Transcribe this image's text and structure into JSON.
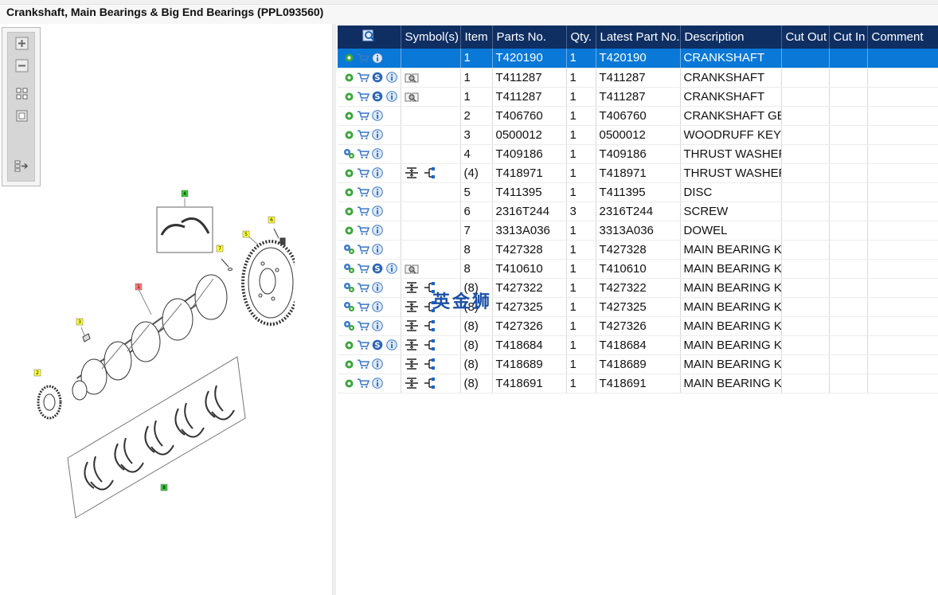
{
  "window": {
    "title": "Crankshaft, Main Bearings & Big End Bearings (PPL093560)"
  },
  "toolbar": {
    "buttons": [
      "zoom-in-icon",
      "zoom-out-icon",
      "fit-page-icon",
      "actual-size-icon",
      "toggle-list-icon"
    ]
  },
  "diagram": {
    "callouts": [
      {
        "id": "c4",
        "label": "4",
        "color": "#33cc33"
      },
      {
        "id": "c6",
        "label": "6",
        "color": "#ffff33"
      },
      {
        "id": "c5",
        "label": "5",
        "color": "#ffff33"
      },
      {
        "id": "c7",
        "label": "7",
        "color": "#ffff33"
      },
      {
        "id": "c1",
        "label": "1",
        "color": "#ff7777"
      },
      {
        "id": "c3",
        "label": "3",
        "color": "#ffff33"
      },
      {
        "id": "c2",
        "label": "2",
        "color": "#ffff33"
      },
      {
        "id": "c8",
        "label": "8",
        "color": "#33cc33"
      }
    ]
  },
  "table": {
    "headers": [
      "",
      "Symbol(s)",
      "Item",
      "Parts No.",
      "Qty.",
      "Latest Part No.",
      "Description",
      "Cut Out",
      "Cut In",
      "Comment"
    ],
    "rows": [
      {
        "icons": [
          "gear",
          "cart",
          "info"
        ],
        "symbols": [],
        "item": "1",
        "part": "T420190",
        "qty": "1",
        "latest": "T420190",
        "desc": "CRANKSHAFT",
        "selected": true
      },
      {
        "icons": [
          "gear",
          "cart",
          "s",
          "info"
        ],
        "symbols": [
          "book"
        ],
        "item": "1",
        "part": "T411287",
        "qty": "1",
        "latest": "T411287",
        "desc": "CRANKSHAFT"
      },
      {
        "icons": [
          "gear",
          "cart",
          "s",
          "info"
        ],
        "symbols": [
          "book"
        ],
        "item": "1",
        "part": "T411287",
        "qty": "1",
        "latest": "T411287",
        "desc": "CRANKSHAFT"
      },
      {
        "icons": [
          "gear",
          "cart",
          "info"
        ],
        "symbols": [],
        "item": "2",
        "part": "T406760",
        "qty": "1",
        "latest": "T406760",
        "desc": "CRANKSHAFT GEAR"
      },
      {
        "icons": [
          "gear",
          "cart",
          "info"
        ],
        "symbols": [],
        "item": "3",
        "part": "0500012",
        "qty": "1",
        "latest": "0500012",
        "desc": "WOODRUFF KEY"
      },
      {
        "icons": [
          "gears",
          "cart",
          "info"
        ],
        "symbols": [],
        "item": "4",
        "part": "T409186",
        "qty": "1",
        "latest": "T409186",
        "desc": "THRUST WASHER"
      },
      {
        "icons": [
          "gear",
          "cart",
          "info"
        ],
        "symbols": [
          "split",
          "tree"
        ],
        "item": "(4)",
        "part": "T418971",
        "qty": "1",
        "latest": "T418971",
        "desc": "THRUST WASHER"
      },
      {
        "icons": [
          "gear",
          "cart",
          "info"
        ],
        "symbols": [],
        "item": "5",
        "part": "T411395",
        "qty": "1",
        "latest": "T411395",
        "desc": "DISC"
      },
      {
        "icons": [
          "gear",
          "cart",
          "info"
        ],
        "symbols": [],
        "item": "6",
        "part": "2316T244",
        "qty": "3",
        "latest": "2316T244",
        "desc": "SCREW"
      },
      {
        "icons": [
          "gear",
          "cart",
          "info"
        ],
        "symbols": [],
        "item": "7",
        "part": "3313A036",
        "qty": "1",
        "latest": "3313A036",
        "desc": "DOWEL"
      },
      {
        "icons": [
          "gears",
          "cart",
          "info"
        ],
        "symbols": [],
        "item": "8",
        "part": "T427328",
        "qty": "1",
        "latest": "T427328",
        "desc": "MAIN BEARING KIT"
      },
      {
        "icons": [
          "gears",
          "cart",
          "s",
          "info"
        ],
        "symbols": [
          "book"
        ],
        "item": "8",
        "part": "T410610",
        "qty": "1",
        "latest": "T410610",
        "desc": "MAIN BEARING KIT"
      },
      {
        "icons": [
          "gears",
          "cart",
          "info"
        ],
        "symbols": [
          "split",
          "tree"
        ],
        "item": "(8)",
        "part": "T427322",
        "qty": "1",
        "latest": "T427322",
        "desc": "MAIN BEARING KIT"
      },
      {
        "icons": [
          "gears",
          "cart",
          "info"
        ],
        "symbols": [
          "split",
          "tree"
        ],
        "item": "(8)",
        "part": "T427325",
        "qty": "1",
        "latest": "T427325",
        "desc": "MAIN BEARING KIT"
      },
      {
        "icons": [
          "gears",
          "cart",
          "info"
        ],
        "symbols": [
          "split",
          "tree"
        ],
        "item": "(8)",
        "part": "T427326",
        "qty": "1",
        "latest": "T427326",
        "desc": "MAIN BEARING KIT"
      },
      {
        "icons": [
          "gear",
          "cart",
          "s",
          "info"
        ],
        "symbols": [
          "split",
          "tree"
        ],
        "item": "(8)",
        "part": "T418684",
        "qty": "1",
        "latest": "T418684",
        "desc": "MAIN BEARING KIT"
      },
      {
        "icons": [
          "gear",
          "cart",
          "info"
        ],
        "symbols": [
          "split",
          "tree"
        ],
        "item": "(8)",
        "part": "T418689",
        "qty": "1",
        "latest": "T418689",
        "desc": "MAIN BEARING KIT"
      },
      {
        "icons": [
          "gear",
          "cart",
          "info"
        ],
        "symbols": [
          "split",
          "tree"
        ],
        "item": "(8)",
        "part": "T418691",
        "qty": "1",
        "latest": "T418691",
        "desc": "MAIN BEARING KIT"
      }
    ]
  },
  "watermark": "英金狮",
  "colors": {
    "header_bg": "#0f2f63",
    "selected_bg": "#0a78d7",
    "accent_green": "#3aa63a",
    "info_blue": "#3c78c8"
  }
}
